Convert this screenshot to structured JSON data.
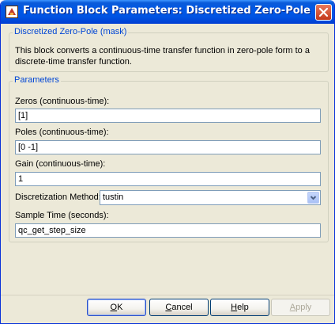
{
  "window": {
    "title": "Function Block Parameters: Discretized Zero-Pole"
  },
  "mask": {
    "group_label": "Discretized Zero-Pole (mask)",
    "description": "This block converts a continuous-time transfer function in zero-pole form to a discrete-time transfer function."
  },
  "parameters": {
    "group_label": "Parameters",
    "zeros": {
      "label": "Zeros (continuous-time):",
      "value": "[1]"
    },
    "poles": {
      "label": "Poles (continuous-time):",
      "value": "[0 -1]"
    },
    "gain": {
      "label": "Gain (continuous-time):",
      "value": "1"
    },
    "method": {
      "label": "Discretization Method:",
      "value": "tustin"
    },
    "sample_time": {
      "label": "Sample Time (seconds):",
      "value": "qc_get_step_size"
    }
  },
  "buttons": {
    "ok": {
      "mnemonic": "O",
      "rest": "K"
    },
    "cancel": {
      "mnemonic": "C",
      "rest": "ancel"
    },
    "help": {
      "mnemonic": "H",
      "rest": "elp"
    },
    "apply": {
      "mnemonic": "A",
      "rest": "pply"
    }
  },
  "icons": {
    "app": "simulink-block-icon",
    "close": "close-icon",
    "dropdown": "chevron-down-icon"
  },
  "colors": {
    "titlebar": "#0054e3",
    "group_label": "#0046d5",
    "dialog_bg": "#ece9d8",
    "close_button": "#c3371a"
  }
}
